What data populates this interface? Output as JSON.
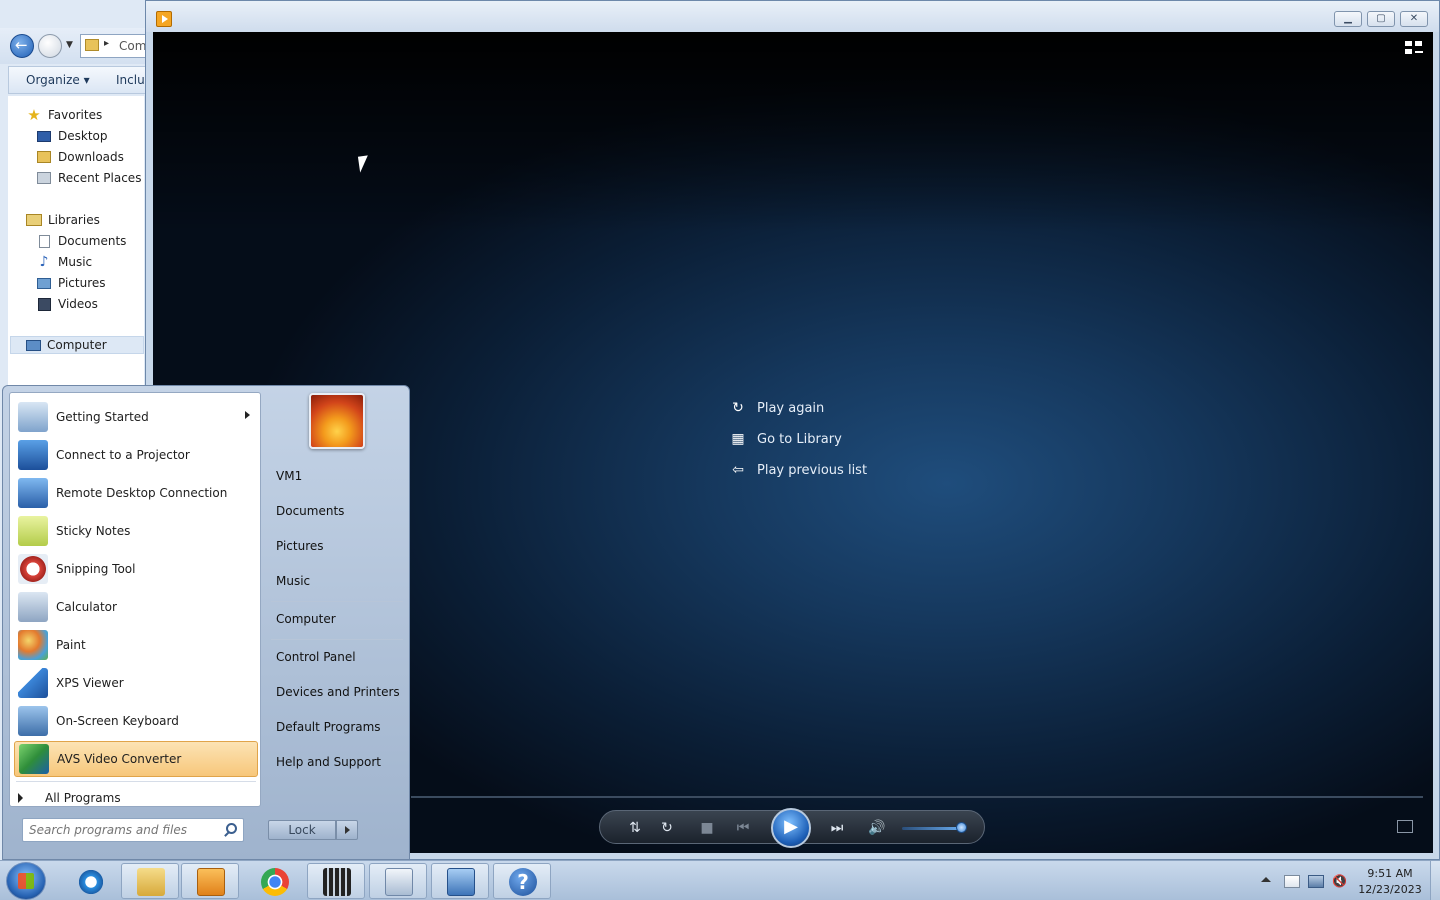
{
  "explorer": {
    "address_text": "Com",
    "organize_label": "Organize ▾",
    "include_label": "Inclu",
    "favorites": {
      "label": "Favorites",
      "items": [
        {
          "label": "Desktop",
          "icon": "desktop-icon"
        },
        {
          "label": "Downloads",
          "icon": "downloads-icon"
        },
        {
          "label": "Recent Places",
          "icon": "recent-places-icon"
        }
      ]
    },
    "libraries": {
      "label": "Libraries",
      "items": [
        {
          "label": "Documents",
          "icon": "document-icon"
        },
        {
          "label": "Music",
          "icon": "music-icon"
        },
        {
          "label": "Pictures",
          "icon": "pictures-icon"
        },
        {
          "label": "Videos",
          "icon": "videos-icon"
        }
      ]
    },
    "computer_label": "Computer"
  },
  "player": {
    "links": [
      {
        "label": "Play again",
        "icon": "replay-icon"
      },
      {
        "label": "Go to Library",
        "icon": "library-icon"
      },
      {
        "label": "Play previous list",
        "icon": "back-arrow-icon"
      }
    ],
    "controls": {
      "shuffle": "⇅",
      "repeat": "↻",
      "stop": "■",
      "prev": "⏮",
      "play": "▶",
      "next": "⏭",
      "mute": "🔊"
    },
    "volume_fraction": 0.9,
    "accent": "#1d5fb7"
  },
  "start_menu": {
    "programs": [
      {
        "label": "Getting Started",
        "icon": "getting-started-icon",
        "submenu": true
      },
      {
        "label": "Connect to a Projector",
        "icon": "projector-icon"
      },
      {
        "label": "Remote Desktop Connection",
        "icon": "remote-desktop-icon"
      },
      {
        "label": "Sticky Notes",
        "icon": "sticky-notes-icon"
      },
      {
        "label": "Snipping Tool",
        "icon": "snipping-tool-icon"
      },
      {
        "label": "Calculator",
        "icon": "calculator-icon"
      },
      {
        "label": "Paint",
        "icon": "paint-icon"
      },
      {
        "label": "XPS Viewer",
        "icon": "xps-viewer-icon"
      },
      {
        "label": "On-Screen Keyboard",
        "icon": "keyboard-icon"
      },
      {
        "label": "AVS Video Converter",
        "icon": "avs-video-converter-icon",
        "highlighted": true
      }
    ],
    "all_programs": "All Programs",
    "search_placeholder": "Search programs and files",
    "user_name": "VM1",
    "right_links": [
      "Documents",
      "Pictures",
      "Music",
      "Computer",
      "Control Panel",
      "Devices and Printers",
      "Default Programs",
      "Help and Support"
    ],
    "lock_label": "Lock",
    "highlight_color": "#f7c77b"
  },
  "taskbar": {
    "buttons": [
      {
        "name": "internet-explorer",
        "icon": "internet-explorer-icon"
      },
      {
        "name": "windows-explorer",
        "icon": "folder-icon"
      },
      {
        "name": "media-player",
        "icon": "media-player-icon"
      },
      {
        "name": "chrome",
        "icon": "chrome-icon"
      },
      {
        "name": "movie-maker",
        "icon": "film-icon"
      },
      {
        "name": "file-viewer",
        "icon": "file-icon"
      },
      {
        "name": "remote-desktop",
        "icon": "remote-desktop-icon"
      },
      {
        "name": "help",
        "icon": "help-icon"
      }
    ],
    "clock_time": "9:51 AM",
    "clock_date": "12/23/2023"
  }
}
